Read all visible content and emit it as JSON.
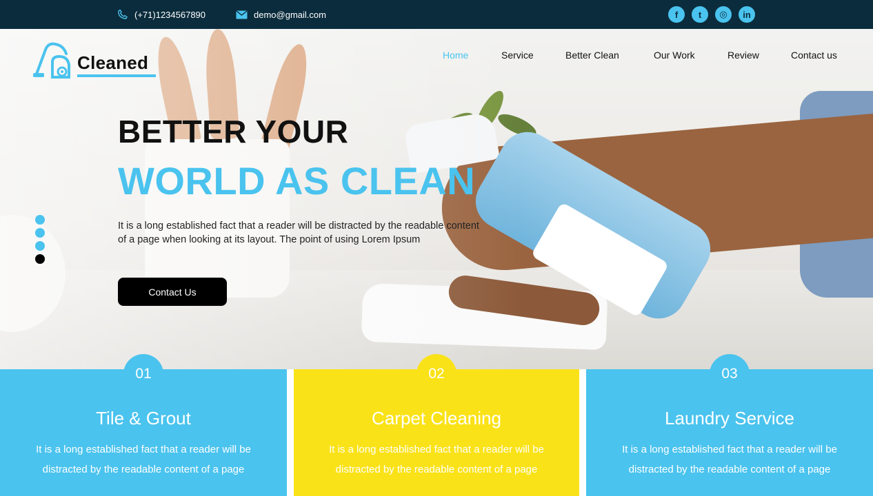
{
  "topbar": {
    "phone": "(+71)1234567890",
    "email": "demo@gmail.com",
    "phone_icon": "phone-icon",
    "email_icon": "mail-icon",
    "socials": [
      {
        "icon": "facebook-icon",
        "glyph": "f"
      },
      {
        "icon": "twitter-icon",
        "glyph": "t"
      },
      {
        "icon": "instagram-icon",
        "glyph": "◎"
      },
      {
        "icon": "linkedin-icon",
        "glyph": "in"
      }
    ]
  },
  "brand": {
    "name": "Cleaned",
    "icon": "vacuum-cleaner-icon"
  },
  "nav": {
    "items": [
      "Home",
      "Service",
      "Better Clean",
      "Our Work",
      "Review",
      "Contact us"
    ],
    "active": "Home"
  },
  "hero": {
    "headline_line1": "BETTER YOUR",
    "headline_line2": "WORLD AS CLEAN",
    "description": "It is a long established fact that a reader will be distracted by the readable content of a page when looking at its layout. The point of using Lorem Ipsum",
    "cta_label": "Contact Us",
    "slide_count": 4,
    "active_slide": 4
  },
  "services": [
    {
      "number": "01",
      "title": "Tile & Grout",
      "line1": "It is a long established fact that a reader will be",
      "line2": "distracted by the readable content of a page"
    },
    {
      "number": "02",
      "title": "Carpet Cleaning",
      "line1": "It is a long established fact that a reader will be",
      "line2": "distracted by the readable content of a page"
    },
    {
      "number": "03",
      "title": "Laundry Service",
      "line1": "It is a long established fact that a reader will be",
      "line2": "distracted by the readable content of a page"
    }
  ],
  "colors": {
    "accent": "#4ac3ee",
    "topbar": "#0b2c3d",
    "yellow": "#fae218",
    "button": "#000000"
  }
}
